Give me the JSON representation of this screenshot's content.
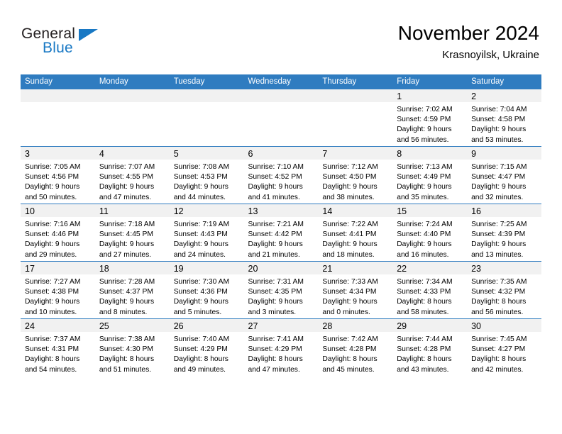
{
  "brand": {
    "name_part1": "General",
    "name_part2": "Blue",
    "triangle_color": "#1878c4"
  },
  "header": {
    "month_title": "November 2024",
    "location": "Krasnoyilsk, Ukraine"
  },
  "theme": {
    "header_blue": "#2f7cc0",
    "daynum_band": "#f1f1f1",
    "text": "#000000"
  },
  "weekdays": [
    "Sunday",
    "Monday",
    "Tuesday",
    "Wednesday",
    "Thursday",
    "Friday",
    "Saturday"
  ],
  "weeks": [
    [
      {
        "day": "",
        "lines": []
      },
      {
        "day": "",
        "lines": []
      },
      {
        "day": "",
        "lines": []
      },
      {
        "day": "",
        "lines": []
      },
      {
        "day": "",
        "lines": []
      },
      {
        "day": "1",
        "lines": [
          "Sunrise: 7:02 AM",
          "Sunset: 4:59 PM",
          "Daylight: 9 hours",
          "and 56 minutes."
        ]
      },
      {
        "day": "2",
        "lines": [
          "Sunrise: 7:04 AM",
          "Sunset: 4:58 PM",
          "Daylight: 9 hours",
          "and 53 minutes."
        ]
      }
    ],
    [
      {
        "day": "3",
        "lines": [
          "Sunrise: 7:05 AM",
          "Sunset: 4:56 PM",
          "Daylight: 9 hours",
          "and 50 minutes."
        ]
      },
      {
        "day": "4",
        "lines": [
          "Sunrise: 7:07 AM",
          "Sunset: 4:55 PM",
          "Daylight: 9 hours",
          "and 47 minutes."
        ]
      },
      {
        "day": "5",
        "lines": [
          "Sunrise: 7:08 AM",
          "Sunset: 4:53 PM",
          "Daylight: 9 hours",
          "and 44 minutes."
        ]
      },
      {
        "day": "6",
        "lines": [
          "Sunrise: 7:10 AM",
          "Sunset: 4:52 PM",
          "Daylight: 9 hours",
          "and 41 minutes."
        ]
      },
      {
        "day": "7",
        "lines": [
          "Sunrise: 7:12 AM",
          "Sunset: 4:50 PM",
          "Daylight: 9 hours",
          "and 38 minutes."
        ]
      },
      {
        "day": "8",
        "lines": [
          "Sunrise: 7:13 AM",
          "Sunset: 4:49 PM",
          "Daylight: 9 hours",
          "and 35 minutes."
        ]
      },
      {
        "day": "9",
        "lines": [
          "Sunrise: 7:15 AM",
          "Sunset: 4:47 PM",
          "Daylight: 9 hours",
          "and 32 minutes."
        ]
      }
    ],
    [
      {
        "day": "10",
        "lines": [
          "Sunrise: 7:16 AM",
          "Sunset: 4:46 PM",
          "Daylight: 9 hours",
          "and 29 minutes."
        ]
      },
      {
        "day": "11",
        "lines": [
          "Sunrise: 7:18 AM",
          "Sunset: 4:45 PM",
          "Daylight: 9 hours",
          "and 27 minutes."
        ]
      },
      {
        "day": "12",
        "lines": [
          "Sunrise: 7:19 AM",
          "Sunset: 4:43 PM",
          "Daylight: 9 hours",
          "and 24 minutes."
        ]
      },
      {
        "day": "13",
        "lines": [
          "Sunrise: 7:21 AM",
          "Sunset: 4:42 PM",
          "Daylight: 9 hours",
          "and 21 minutes."
        ]
      },
      {
        "day": "14",
        "lines": [
          "Sunrise: 7:22 AM",
          "Sunset: 4:41 PM",
          "Daylight: 9 hours",
          "and 18 minutes."
        ]
      },
      {
        "day": "15",
        "lines": [
          "Sunrise: 7:24 AM",
          "Sunset: 4:40 PM",
          "Daylight: 9 hours",
          "and 16 minutes."
        ]
      },
      {
        "day": "16",
        "lines": [
          "Sunrise: 7:25 AM",
          "Sunset: 4:39 PM",
          "Daylight: 9 hours",
          "and 13 minutes."
        ]
      }
    ],
    [
      {
        "day": "17",
        "lines": [
          "Sunrise: 7:27 AM",
          "Sunset: 4:38 PM",
          "Daylight: 9 hours",
          "and 10 minutes."
        ]
      },
      {
        "day": "18",
        "lines": [
          "Sunrise: 7:28 AM",
          "Sunset: 4:37 PM",
          "Daylight: 9 hours",
          "and 8 minutes."
        ]
      },
      {
        "day": "19",
        "lines": [
          "Sunrise: 7:30 AM",
          "Sunset: 4:36 PM",
          "Daylight: 9 hours",
          "and 5 minutes."
        ]
      },
      {
        "day": "20",
        "lines": [
          "Sunrise: 7:31 AM",
          "Sunset: 4:35 PM",
          "Daylight: 9 hours",
          "and 3 minutes."
        ]
      },
      {
        "day": "21",
        "lines": [
          "Sunrise: 7:33 AM",
          "Sunset: 4:34 PM",
          "Daylight: 9 hours",
          "and 0 minutes."
        ]
      },
      {
        "day": "22",
        "lines": [
          "Sunrise: 7:34 AM",
          "Sunset: 4:33 PM",
          "Daylight: 8 hours",
          "and 58 minutes."
        ]
      },
      {
        "day": "23",
        "lines": [
          "Sunrise: 7:35 AM",
          "Sunset: 4:32 PM",
          "Daylight: 8 hours",
          "and 56 minutes."
        ]
      }
    ],
    [
      {
        "day": "24",
        "lines": [
          "Sunrise: 7:37 AM",
          "Sunset: 4:31 PM",
          "Daylight: 8 hours",
          "and 54 minutes."
        ]
      },
      {
        "day": "25",
        "lines": [
          "Sunrise: 7:38 AM",
          "Sunset: 4:30 PM",
          "Daylight: 8 hours",
          "and 51 minutes."
        ]
      },
      {
        "day": "26",
        "lines": [
          "Sunrise: 7:40 AM",
          "Sunset: 4:29 PM",
          "Daylight: 8 hours",
          "and 49 minutes."
        ]
      },
      {
        "day": "27",
        "lines": [
          "Sunrise: 7:41 AM",
          "Sunset: 4:29 PM",
          "Daylight: 8 hours",
          "and 47 minutes."
        ]
      },
      {
        "day": "28",
        "lines": [
          "Sunrise: 7:42 AM",
          "Sunset: 4:28 PM",
          "Daylight: 8 hours",
          "and 45 minutes."
        ]
      },
      {
        "day": "29",
        "lines": [
          "Sunrise: 7:44 AM",
          "Sunset: 4:28 PM",
          "Daylight: 8 hours",
          "and 43 minutes."
        ]
      },
      {
        "day": "30",
        "lines": [
          "Sunrise: 7:45 AM",
          "Sunset: 4:27 PM",
          "Daylight: 8 hours",
          "and 42 minutes."
        ]
      }
    ]
  ]
}
